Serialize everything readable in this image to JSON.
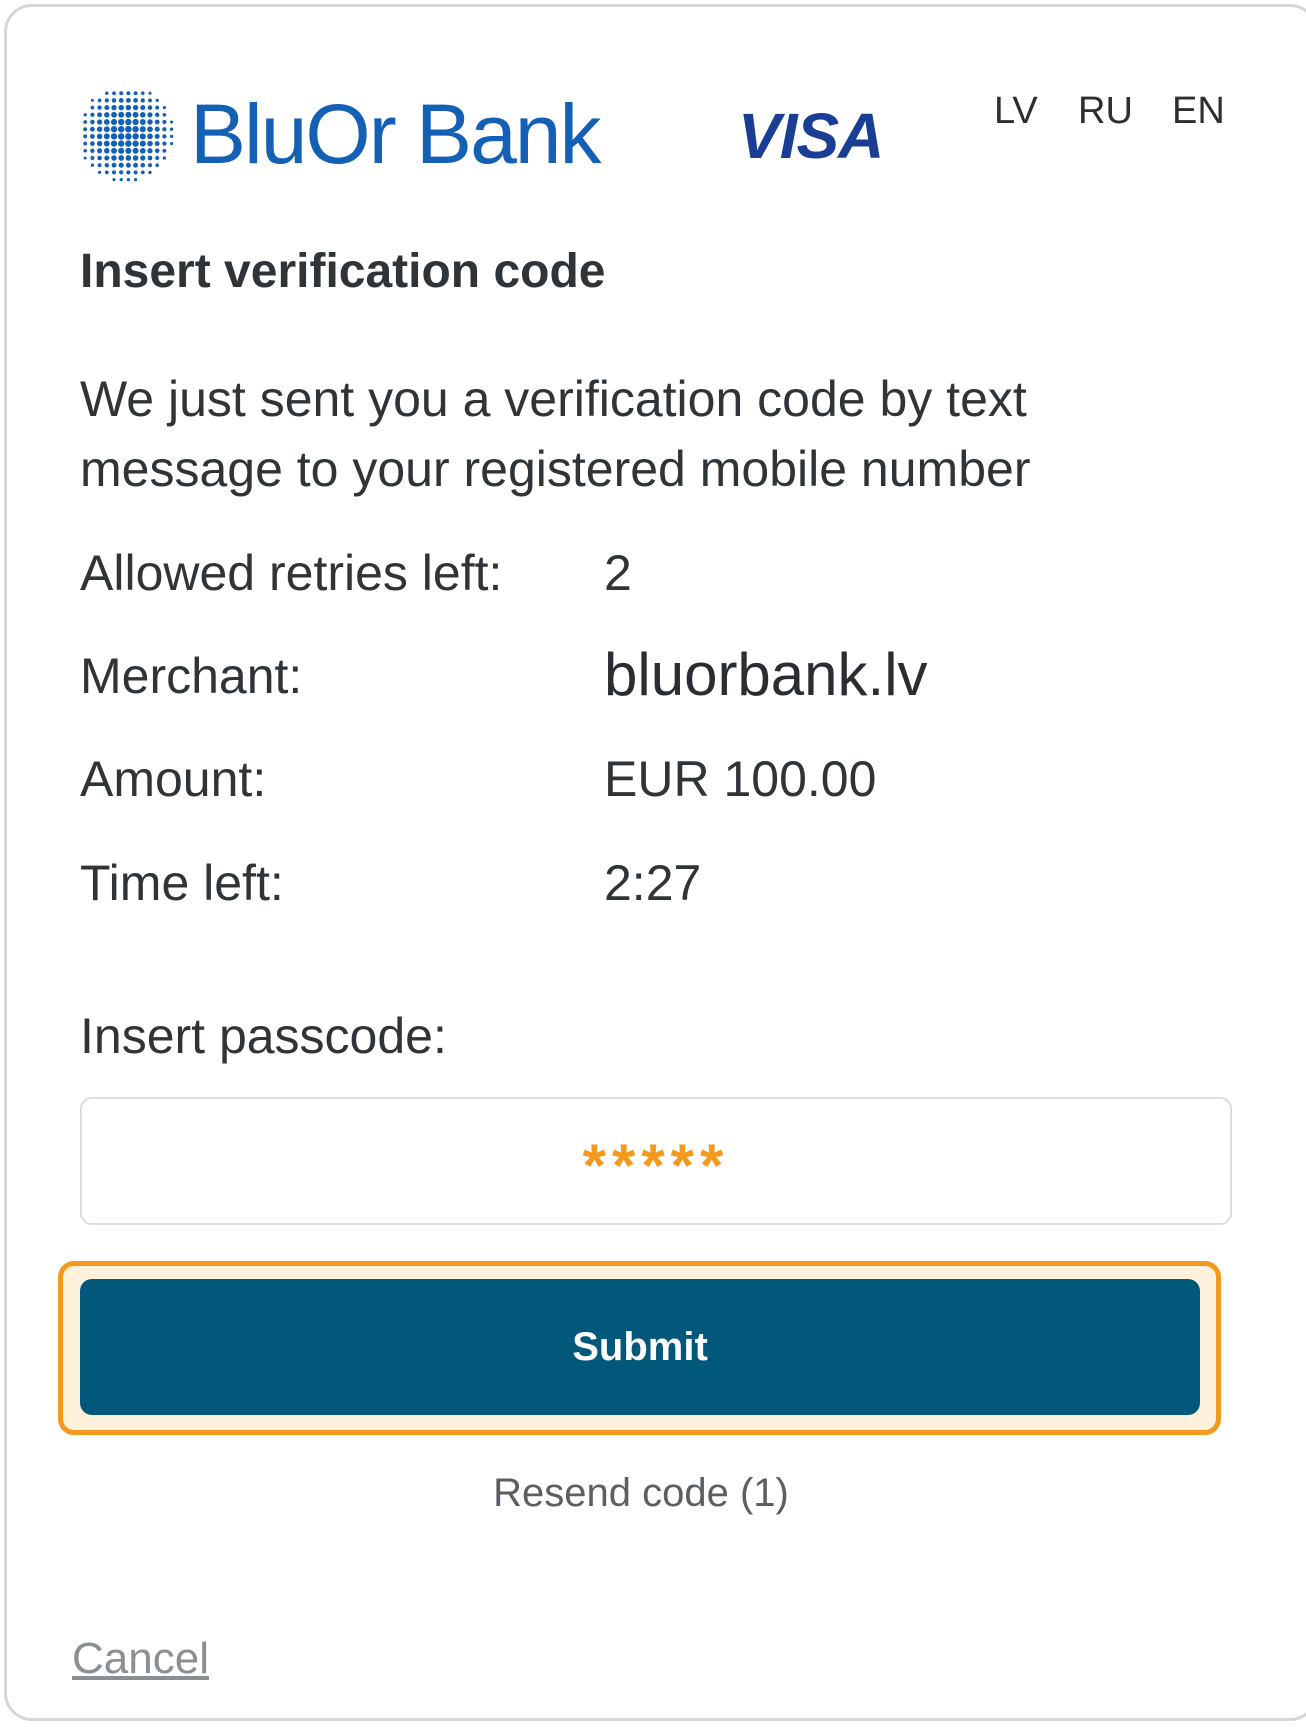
{
  "header": {
    "bank_name": "BluOr Bank",
    "card_brand": "VISA",
    "languages": [
      "LV",
      "RU",
      "EN"
    ]
  },
  "main": {
    "title": "Insert verification code",
    "intro": "We just sent you a verification code by text message to your registered mobile number",
    "details": [
      {
        "label": "Allowed retries left:",
        "value": "2"
      },
      {
        "label": "Merchant:",
        "value": "bluorbank.lv"
      },
      {
        "label": "Amount:",
        "value": "EUR 100.00"
      },
      {
        "label": "Time left:",
        "value": "2:27"
      }
    ],
    "passcode": {
      "label": "Insert passcode:",
      "value": "*****"
    },
    "submit_label": "Submit",
    "resend_label": "Resend code (1)",
    "cancel_label": "Cancel"
  },
  "colors": {
    "brand_blue": "#1460b4",
    "visa_blue": "#1a3e93",
    "button_teal": "#02587a",
    "focus_orange": "#f39a1e"
  }
}
